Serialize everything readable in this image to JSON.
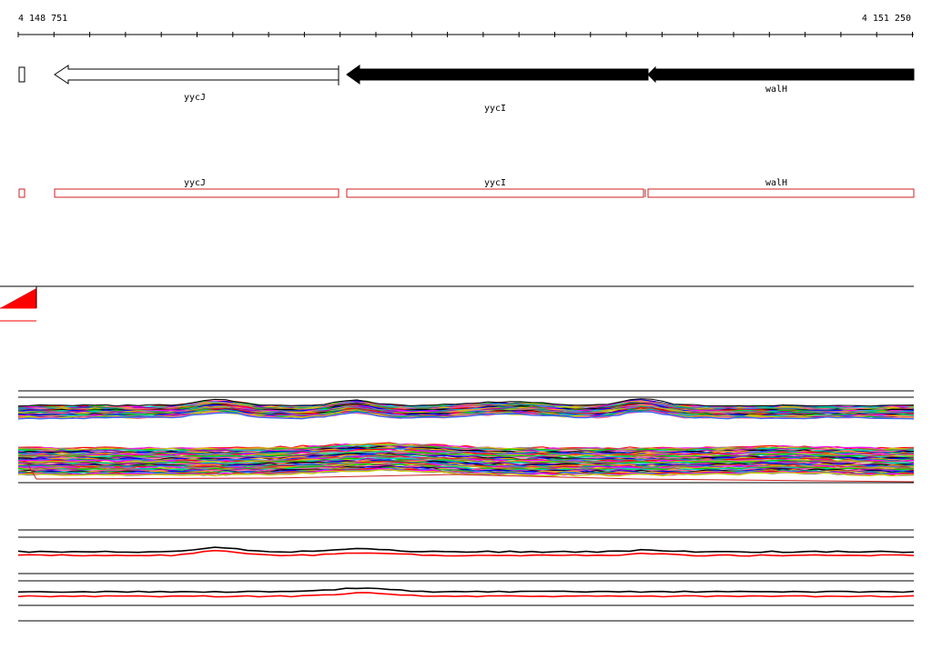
{
  "coordinates": {
    "start": "4 148 751",
    "end": "4 151 250"
  },
  "annotation_track": {
    "genes": [
      {
        "name": "yycJ",
        "strand": "-",
        "fill": "#ffffff"
      },
      {
        "name": "yycI",
        "strand": "-",
        "fill": "#000000"
      },
      {
        "name": "walH",
        "strand": "-",
        "fill": "#000000"
      }
    ]
  },
  "transcript_track": {
    "color": "#cc2222",
    "segments": [
      {
        "name": "yycJ"
      },
      {
        "name": "yycI"
      },
      {
        "name": "walH"
      }
    ]
  },
  "colors": {
    "axis": "#000000",
    "accent": "#ff0000",
    "profile_palette": [
      "#ff0000",
      "#00cc00",
      "#0000ff",
      "#ff00ff",
      "#00cccc",
      "#ffaa00",
      "#888888",
      "#aa00aa",
      "#00aa55",
      "#cccc00",
      "#ff6699",
      "#3366ff",
      "#996633",
      "#000000"
    ]
  }
}
